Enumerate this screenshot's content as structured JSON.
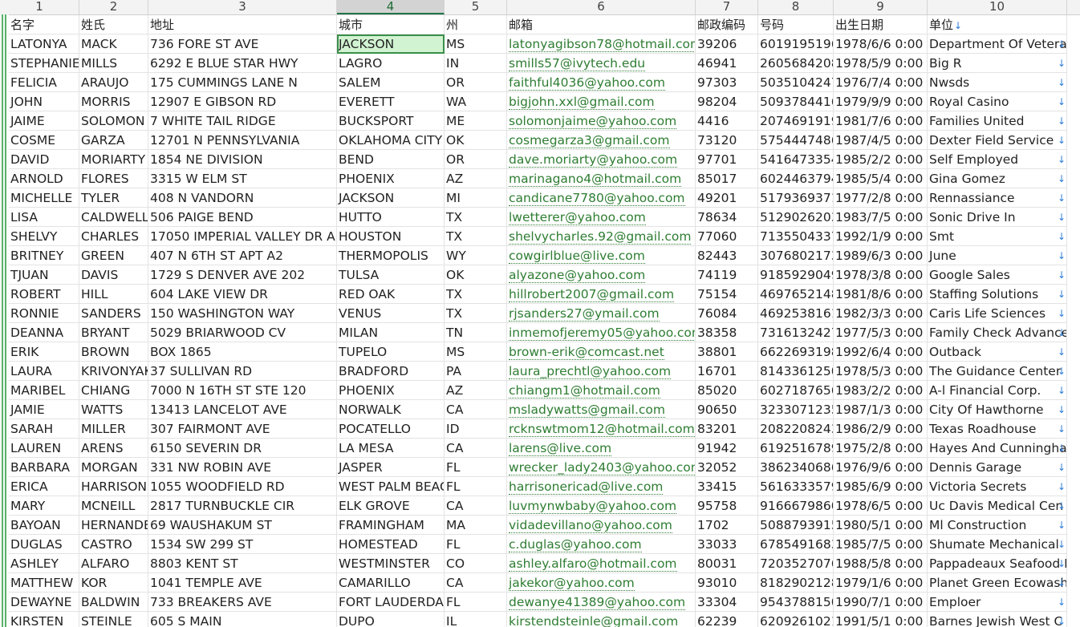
{
  "columns": [
    "1",
    "2",
    "3",
    "4",
    "5",
    "6",
    "7",
    "8",
    "9",
    "10"
  ],
  "active_column": "4",
  "header": [
    "名字",
    "姓氏",
    "地址",
    "城市",
    "州",
    "邮箱",
    "邮政编码",
    "号码",
    "出生日期",
    "单位"
  ],
  "selected_cell": {
    "row": 1,
    "col": 3
  },
  "rows": [
    [
      "LATONYA",
      "MACK",
      "736 FORE ST AVE",
      "JACKSON",
      "MS",
      "latonyagibson78@hotmail.com",
      "39206",
      "6019195196",
      "1978/6/6 0:00",
      "Department Of Vetera"
    ],
    [
      "STEPHANIE",
      "MILLS",
      "6292 E BLUE STAR HWY",
      "LAGRO",
      "IN",
      "smills57@ivytech.edu",
      "46941",
      "2605684208",
      "1978/5/9 0:00",
      "Big R"
    ],
    [
      "FELICIA",
      "ARAUJO",
      "175 CUMMINGS LANE N",
      "SALEM",
      "OR",
      "faithful4036@yahoo.com",
      "97303",
      "5035104247",
      "1976/7/4 0:00",
      "Nwsds"
    ],
    [
      "JOHN",
      "MORRIS",
      "12907 E GIBSON RD",
      "EVERETT",
      "WA",
      "bigjohn.xxl@gmail.com",
      "98204",
      "5093784416",
      "1979/9/9 0:00",
      "Royal Casino"
    ],
    [
      "JAIME",
      "SOLOMON",
      "7 WHITE TAIL RIDGE",
      "BUCKSPORT",
      "ME",
      "solomonjaime@yahoo.com",
      "4416",
      "2074691919",
      "1981/7/6 0:00",
      "Families United"
    ],
    [
      "COSME",
      "GARZA",
      "12701 N PENNSYLVANIA",
      "OKLAHOMA CITY",
      "OK",
      "cosmegarza3@gmail.com",
      "73120",
      "5754447486",
      "1987/4/5 0:00",
      "Dexter Field Service"
    ],
    [
      "DAVID",
      "MORIARTY",
      "1854 NE DIVISION",
      "BEND",
      "OR",
      "dave.moriarty@yahoo.com",
      "97701",
      "5416473354",
      "1985/2/2 0:00",
      "Self Employed"
    ],
    [
      "ARNOLD",
      "FLORES",
      "3315 W ELM ST",
      "PHOENIX",
      "AZ",
      "marinagano4@hotmail.com",
      "85017",
      "6024463794",
      "1985/5/4 0:00",
      "Gina Gomez"
    ],
    [
      "MICHELLE",
      "TYLER",
      "408 N VANDORN",
      "JACKSON",
      "MI",
      "candicane7780@yahoo.com",
      "49201",
      "5179369371",
      "1977/2/8 0:00",
      "Rennassiance"
    ],
    [
      "LISA",
      "CALDWELL",
      "506 PAIGE BEND",
      "HUTTO",
      "TX",
      "lwetterer@yahoo.com",
      "78634",
      "5129026203",
      "1983/7/5 0:00",
      "Sonic Drive In"
    ],
    [
      "SHELVY",
      "CHARLES",
      "17050 IMPERIAL VALLEY DR AP",
      "HOUSTON",
      "TX",
      "shelvycharles.92@gmail.com",
      "77060",
      "7135504337",
      "1992/1/9 0:00",
      "Smt"
    ],
    [
      "BRITNEY",
      "GREEN",
      "407 N 6TH ST APT A2",
      "THERMOPOLIS",
      "WY",
      "cowgirlblue@live.com",
      "82443",
      "3076802173",
      "1989/6/3 0:00",
      "June"
    ],
    [
      "TJUAN",
      "DAVIS",
      "1729 S DENVER AVE 202",
      "TULSA",
      "OK",
      "alyazone@yahoo.com",
      "74119",
      "9185929049",
      "1978/3/8 0:00",
      "Google Sales"
    ],
    [
      "ROBERT",
      "HILL",
      "604 LAKE VIEW DR",
      "RED OAK",
      "TX",
      "hillrobert2007@gmail.com",
      "75154",
      "4697652148",
      "1981/8/6 0:00",
      "Staffing Solutions"
    ],
    [
      "RONNIE",
      "SANDERS",
      "150 WASHINGTON WAY",
      "VENUS",
      "TX",
      "rjsanders27@ymail.com",
      "76084",
      "4692538161",
      "1982/3/3 0:00",
      "Caris Life Sciences"
    ],
    [
      "DEANNA",
      "BRYANT",
      "5029 BRIARWOOD CV",
      "MILAN",
      "TN",
      "inmemofjeremy05@yahoo.com",
      "38358",
      "7316132427",
      "1977/5/3 0:00",
      "Family Check Advance"
    ],
    [
      "ERIK",
      "BROWN",
      "BOX 1865",
      "TUPELO",
      "MS",
      "brown-erik@comcast.net",
      "38801",
      "6622693198",
      "1992/6/4 0:00",
      "Outback"
    ],
    [
      "LAURA",
      "KRIVONYAK",
      "37 SULLIVAN RD",
      "BRADFORD",
      "PA",
      "laura_prechtl@yahoo.com",
      "16701",
      "8143361250",
      "1978/5/3 0:00",
      "The Guidance Center"
    ],
    [
      "MARIBEL",
      "CHIANG",
      "7000 N 16TH ST STE 120",
      "PHOENIX",
      "AZ",
      "chiangm1@hotmail.com",
      "85020",
      "6027187656",
      "1983/2/2 0:00",
      "A-l Financial Corp."
    ],
    [
      "JAMIE",
      "WATTS",
      "13413 LANCELOT AVE",
      "NORWALK",
      "CA",
      "msladywatts@gmail.com",
      "90650",
      "3233071235",
      "1987/1/3 0:00",
      "City Of Hawthorne"
    ],
    [
      "SARAH",
      "MILLER",
      "307 FAIRMONT AVE",
      "POCATELLO",
      "ID",
      "rcknswtmom12@hotmail.com",
      "83201",
      "2082208243",
      "1986/2/9 0:00",
      "Texas Roadhouse"
    ],
    [
      "LAUREN",
      "ARENS",
      "6150 SEVERIN DR",
      "LA MESA",
      "CA",
      "larens@live.com",
      "91942",
      "6192516789",
      "1975/2/8 0:00",
      "Hayes And Cunninghar"
    ],
    [
      "BARBARA",
      "MORGAN",
      "331 NW ROBIN AVE",
      "JASPER",
      "FL",
      "wrecker_lady2403@yahoo.com",
      "32052",
      "3862340686",
      "1976/9/6 0:00",
      "Dennis Garage"
    ],
    [
      "ERICA",
      "HARRISON",
      "1055 WOODFIELD RD",
      "WEST PALM BEACH",
      "FL",
      "harrisonericad@live.com",
      "33415",
      "5616333579",
      "1985/6/9 0:00",
      "Victoria Secrets"
    ],
    [
      "MARY",
      "MCNEILL",
      "2817 TURNBUCKLE CIR",
      "ELK GROVE",
      "CA",
      "luvmynwbaby@yahoo.com",
      "95758",
      "9166679860",
      "1978/6/5 0:00",
      "Uc Davis Medical Cen"
    ],
    [
      "BAYOAN",
      "HERNANDEZ",
      "69 WAUSHAKUM ST",
      "FRAMINGHAM",
      "MA",
      "vidadevillano@yahoo.com",
      "1702",
      "5088793915",
      "1980/5/1 0:00",
      "Ml Construction"
    ],
    [
      "DUGLAS",
      "CASTRO",
      "1534 SW 299 ST",
      "HOMESTEAD",
      "FL",
      "c.duglas@yahoo.com",
      "33033",
      "6785491683",
      "1985/7/5 0:00",
      "Shumate Mechanical"
    ],
    [
      "ASHLEY",
      "ALFARO",
      "8803 KENT ST",
      "WESTMINSTER",
      "CO",
      "ashley.alfaro@hotmail.com",
      "80031",
      "7203527076",
      "1988/5/8 0:00",
      "Pappadeaux Seafood K"
    ],
    [
      "MATTHEW",
      "KOR",
      "1041 TEMPLE AVE",
      "CAMARILLO",
      "CA",
      "jakekor@yahoo.com",
      "93010",
      "8182902128",
      "1979/1/6 0:00",
      "Planet Green Ecowash"
    ],
    [
      "DEWAYNE",
      "BALDWIN",
      "733 BREAKERS AVE",
      "FORT LAUDERDALE",
      "FL",
      "dewanye41389@yahoo.com",
      "33304",
      "9543788150",
      "1990/7/1 0:00",
      "Emploer"
    ],
    [
      "KIRSTEN",
      "STEINLE",
      "605 S MAIN",
      "DUPO",
      "IL",
      "kirstendsteinle@gmail.com",
      "62239",
      "6209261021",
      "1991/5/1 0:00",
      "Barnes Jewish West C"
    ]
  ]
}
